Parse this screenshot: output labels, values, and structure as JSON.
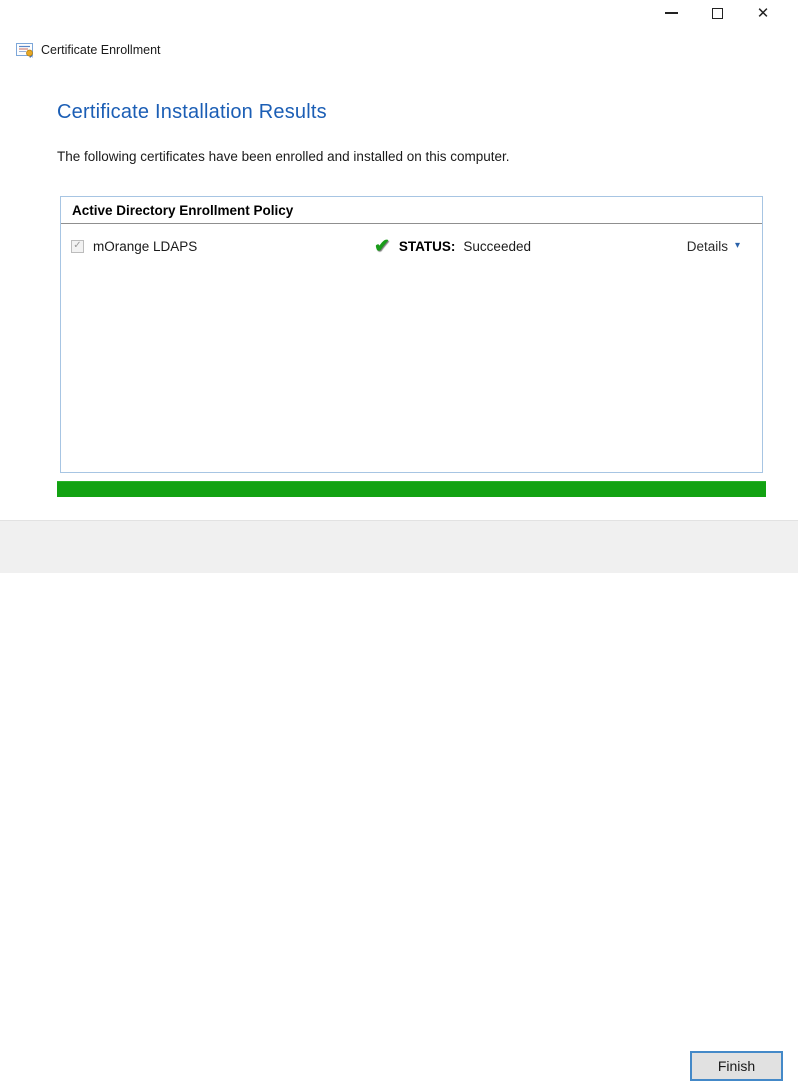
{
  "window": {
    "title": "Certificate Enrollment",
    "controls": {
      "minimize_icon": "minimize-icon",
      "maximize_icon": "maximize-icon",
      "close_icon": "close-icon",
      "close_glyph": "✕"
    }
  },
  "page": {
    "heading": "Certificate Installation Results",
    "description": "The following certificates have been enrolled and installed on this computer."
  },
  "panel": {
    "header": "Active Directory Enrollment Policy",
    "rows": [
      {
        "checkbox_checked": true,
        "checkbox_glyph": "✓",
        "name": "mOrange LDAPS",
        "status_icon_glyph": "✔",
        "status_label": "STATUS:",
        "status_value": "Succeeded",
        "details_label": "Details",
        "details_chevron_glyph": "▾"
      }
    ],
    "progress": {
      "value_percent": 100
    }
  },
  "footer": {
    "finish_label": "Finish"
  },
  "colors": {
    "heading_blue": "#1b5eb5",
    "panel_border_blue": "#a7c5e3",
    "progress_green": "#12a212",
    "status_check_green": "#1a9c1a",
    "details_chevron_blue": "#2b62a9",
    "footer_gray": "#f0f0f0",
    "button_border_blue": "#4489c8"
  }
}
